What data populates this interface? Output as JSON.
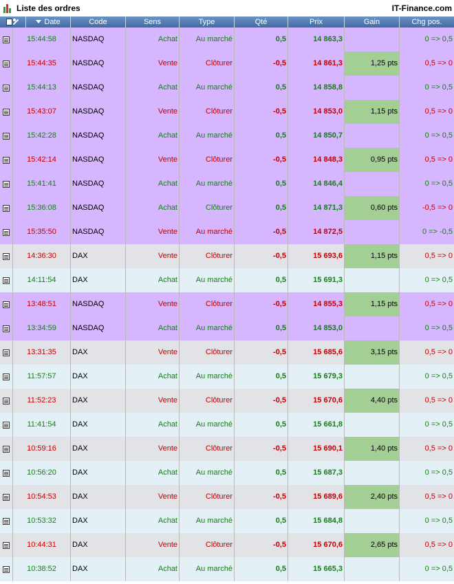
{
  "window": {
    "title": "Liste des ordres",
    "brand": "IT-Finance.com",
    "icon": "bar-chart-icon"
  },
  "columns": [
    "Date",
    "Code",
    "Sens",
    "Type",
    "Qté",
    "Prix",
    "Gain",
    "Chg pos."
  ],
  "colors": {
    "buy": "#128012",
    "sell": "#c10000",
    "nasdaq_row": "#d6b6ff",
    "dax_sell_row": "#e1e3e6",
    "dax_buy_row": "#e3f0f6",
    "gain_cell": "#a3cf95",
    "header": "#4a76ae"
  },
  "orders": [
    {
      "time": "15:44:58",
      "code": "NASDAQ",
      "sens": "Achat",
      "type": "Au marché",
      "qty": "0,5",
      "price": "14 863,3",
      "gain": "",
      "chg": "0 => 0,5"
    },
    {
      "time": "15:44:35",
      "code": "NASDAQ",
      "sens": "Vente",
      "type": "Clôturer",
      "qty": "-0,5",
      "price": "14 861,3",
      "gain": "1,25 pts",
      "chg": "0,5 => 0"
    },
    {
      "time": "15:44:13",
      "code": "NASDAQ",
      "sens": "Achat",
      "type": "Au marché",
      "qty": "0,5",
      "price": "14 858,8",
      "gain": "",
      "chg": "0 => 0,5"
    },
    {
      "time": "15:43:07",
      "code": "NASDAQ",
      "sens": "Vente",
      "type": "Clôturer",
      "qty": "-0,5",
      "price": "14 853,0",
      "gain": "1,15 pts",
      "chg": "0,5 => 0"
    },
    {
      "time": "15:42:28",
      "code": "NASDAQ",
      "sens": "Achat",
      "type": "Au marché",
      "qty": "0,5",
      "price": "14 850,7",
      "gain": "",
      "chg": "0 => 0,5"
    },
    {
      "time": "15:42:14",
      "code": "NASDAQ",
      "sens": "Vente",
      "type": "Clôturer",
      "qty": "-0,5",
      "price": "14 848,3",
      "gain": "0,95 pts",
      "chg": "0,5 => 0"
    },
    {
      "time": "15:41:41",
      "code": "NASDAQ",
      "sens": "Achat",
      "type": "Au marché",
      "qty": "0,5",
      "price": "14 846,4",
      "gain": "",
      "chg": "0 => 0,5"
    },
    {
      "time": "15:36:08",
      "code": "NASDAQ",
      "sens": "Achat",
      "type": "Clôturer",
      "qty": "0,5",
      "price": "14 871,3",
      "gain": "0,60 pts",
      "chg": "-0,5 => 0"
    },
    {
      "time": "15:35:50",
      "code": "NASDAQ",
      "sens": "Vente",
      "type": "Au marché",
      "qty": "-0,5",
      "price": "14 872,5",
      "gain": "",
      "chg": "0 => -0,5"
    },
    {
      "time": "14:36:30",
      "code": "DAX",
      "sens": "Vente",
      "type": "Clôturer",
      "qty": "-0,5",
      "price": "15 693,6",
      "gain": "1,15 pts",
      "chg": "0,5 => 0"
    },
    {
      "time": "14:11:54",
      "code": "DAX",
      "sens": "Achat",
      "type": "Au marché",
      "qty": "0,5",
      "price": "15 691,3",
      "gain": "",
      "chg": "0 => 0,5"
    },
    {
      "time": "13:48:51",
      "code": "NASDAQ",
      "sens": "Vente",
      "type": "Clôturer",
      "qty": "-0,5",
      "price": "14 855,3",
      "gain": "1,15 pts",
      "chg": "0,5 => 0"
    },
    {
      "time": "13:34:59",
      "code": "NASDAQ",
      "sens": "Achat",
      "type": "Au marché",
      "qty": "0,5",
      "price": "14 853,0",
      "gain": "",
      "chg": "0 => 0,5"
    },
    {
      "time": "13:31:35",
      "code": "DAX",
      "sens": "Vente",
      "type": "Clôturer",
      "qty": "-0,5",
      "price": "15 685,6",
      "gain": "3,15 pts",
      "chg": "0,5 => 0"
    },
    {
      "time": "11:57:57",
      "code": "DAX",
      "sens": "Achat",
      "type": "Au marché",
      "qty": "0,5",
      "price": "15 679,3",
      "gain": "",
      "chg": "0 => 0,5"
    },
    {
      "time": "11:52:23",
      "code": "DAX",
      "sens": "Vente",
      "type": "Clôturer",
      "qty": "-0,5",
      "price": "15 670,6",
      "gain": "4,40 pts",
      "chg": "0,5 => 0"
    },
    {
      "time": "11:41:54",
      "code": "DAX",
      "sens": "Achat",
      "type": "Au marché",
      "qty": "0,5",
      "price": "15 661,8",
      "gain": "",
      "chg": "0 => 0,5"
    },
    {
      "time": "10:59:16",
      "code": "DAX",
      "sens": "Vente",
      "type": "Clôturer",
      "qty": "-0,5",
      "price": "15 690,1",
      "gain": "1,40 pts",
      "chg": "0,5 => 0"
    },
    {
      "time": "10:56:20",
      "code": "DAX",
      "sens": "Achat",
      "type": "Au marché",
      "qty": "0,5",
      "price": "15 687,3",
      "gain": "",
      "chg": "0 => 0,5"
    },
    {
      "time": "10:54:53",
      "code": "DAX",
      "sens": "Vente",
      "type": "Clôturer",
      "qty": "-0,5",
      "price": "15 689,6",
      "gain": "2,40 pts",
      "chg": "0,5 => 0"
    },
    {
      "time": "10:53:32",
      "code": "DAX",
      "sens": "Achat",
      "type": "Au marché",
      "qty": "0,5",
      "price": "15 684,8",
      "gain": "",
      "chg": "0 => 0,5"
    },
    {
      "time": "10:44:31",
      "code": "DAX",
      "sens": "Vente",
      "type": "Clôturer",
      "qty": "-0,5",
      "price": "15 670,6",
      "gain": "2,65 pts",
      "chg": "0,5 => 0"
    },
    {
      "time": "10:38:52",
      "code": "DAX",
      "sens": "Achat",
      "type": "Au marché",
      "qty": "0,5",
      "price": "15 665,3",
      "gain": "",
      "chg": "0 => 0,5"
    }
  ]
}
